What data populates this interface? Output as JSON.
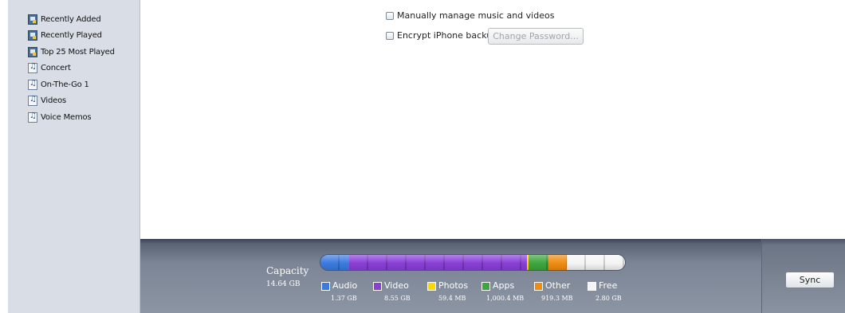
{
  "sidebar": {
    "items": [
      {
        "label": "Recently Added",
        "icon": "smart-playlist-icon"
      },
      {
        "label": "Recently Played",
        "icon": "smart-playlist-icon"
      },
      {
        "label": "Top 25 Most Played",
        "icon": "smart-playlist-icon"
      },
      {
        "label": "Concert",
        "icon": "playlist-icon"
      },
      {
        "label": "On-The-Go 1",
        "icon": "playlist-icon"
      },
      {
        "label": "Videos",
        "icon": "playlist-icon"
      },
      {
        "label": "Voice Memos",
        "icon": "playlist-icon"
      }
    ]
  },
  "options": {
    "manual_manage_label": "Manually manage music and videos",
    "manual_manage_checked": false,
    "encrypt_backup_label": "Encrypt iPhone backup",
    "encrypt_backup_checked": false,
    "change_password_label": "Change Password..."
  },
  "capacity": {
    "title": "Capacity",
    "total": "14.64 GB",
    "legend": [
      {
        "name": "Audio",
        "size": "1.37 GB",
        "color": "#3b7be0",
        "fraction": 0.094
      },
      {
        "name": "Video",
        "size": "8.55 GB",
        "color": "#8a3fd8",
        "fraction": 0.584
      },
      {
        "name": "Photos",
        "size": "59.4 MB",
        "color": "#ffd800",
        "fraction": 0.004
      },
      {
        "name": "Apps",
        "size": "1,000.4 MB",
        "color": "#3da63d",
        "fraction": 0.067
      },
      {
        "name": "Other",
        "size": "919.3 MB",
        "color": "#f08c10",
        "fraction": 0.061
      },
      {
        "name": "Free",
        "size": "2.80 GB",
        "color": "#f4f4f4",
        "fraction": 0.19
      }
    ]
  },
  "footer": {
    "sync_label": "Sync"
  }
}
